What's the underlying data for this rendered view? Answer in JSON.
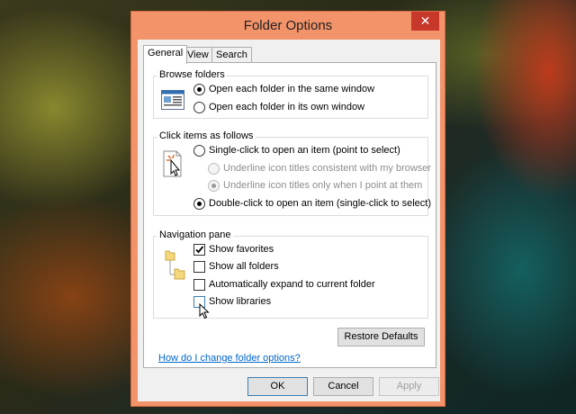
{
  "window": {
    "title": "Folder Options",
    "close_glyph": "✕",
    "tabs": [
      "General",
      "View",
      "Search"
    ],
    "active_tab": "General"
  },
  "browse_folders": {
    "title": "Browse folders",
    "icon": "window-icon",
    "options": [
      {
        "label": "Open each folder in the same window",
        "checked": true
      },
      {
        "label": "Open each folder in its own window",
        "checked": false
      }
    ]
  },
  "click_items": {
    "title": "Click items as follows",
    "icon": "click-cursor-icon",
    "single_click": {
      "label": "Single-click to open an item (point to select)",
      "checked": false
    },
    "underline_consistent": {
      "label": "Underline icon titles consistent with my browser",
      "checked": false,
      "disabled": true
    },
    "underline_point": {
      "label": "Underline icon titles only when I point at them",
      "checked": true,
      "disabled": true
    },
    "double_click": {
      "label": "Double-click to open an item (single-click to select)",
      "checked": true
    }
  },
  "navigation_pane": {
    "title": "Navigation pane",
    "icon": "folder-tree-icon",
    "options": [
      {
        "label": "Show favorites",
        "checked": true
      },
      {
        "label": "Show all folders",
        "checked": false
      },
      {
        "label": "Automatically expand to current folder",
        "checked": false
      },
      {
        "label": "Show libraries",
        "checked": false
      }
    ]
  },
  "restore_defaults": "Restore Defaults",
  "help_link": "How do I change folder options?",
  "buttons": {
    "ok": "OK",
    "cancel": "Cancel",
    "apply": "Apply"
  },
  "colors": {
    "frame": "#f2936a",
    "close": "#c7372a",
    "link": "#0066cc"
  }
}
